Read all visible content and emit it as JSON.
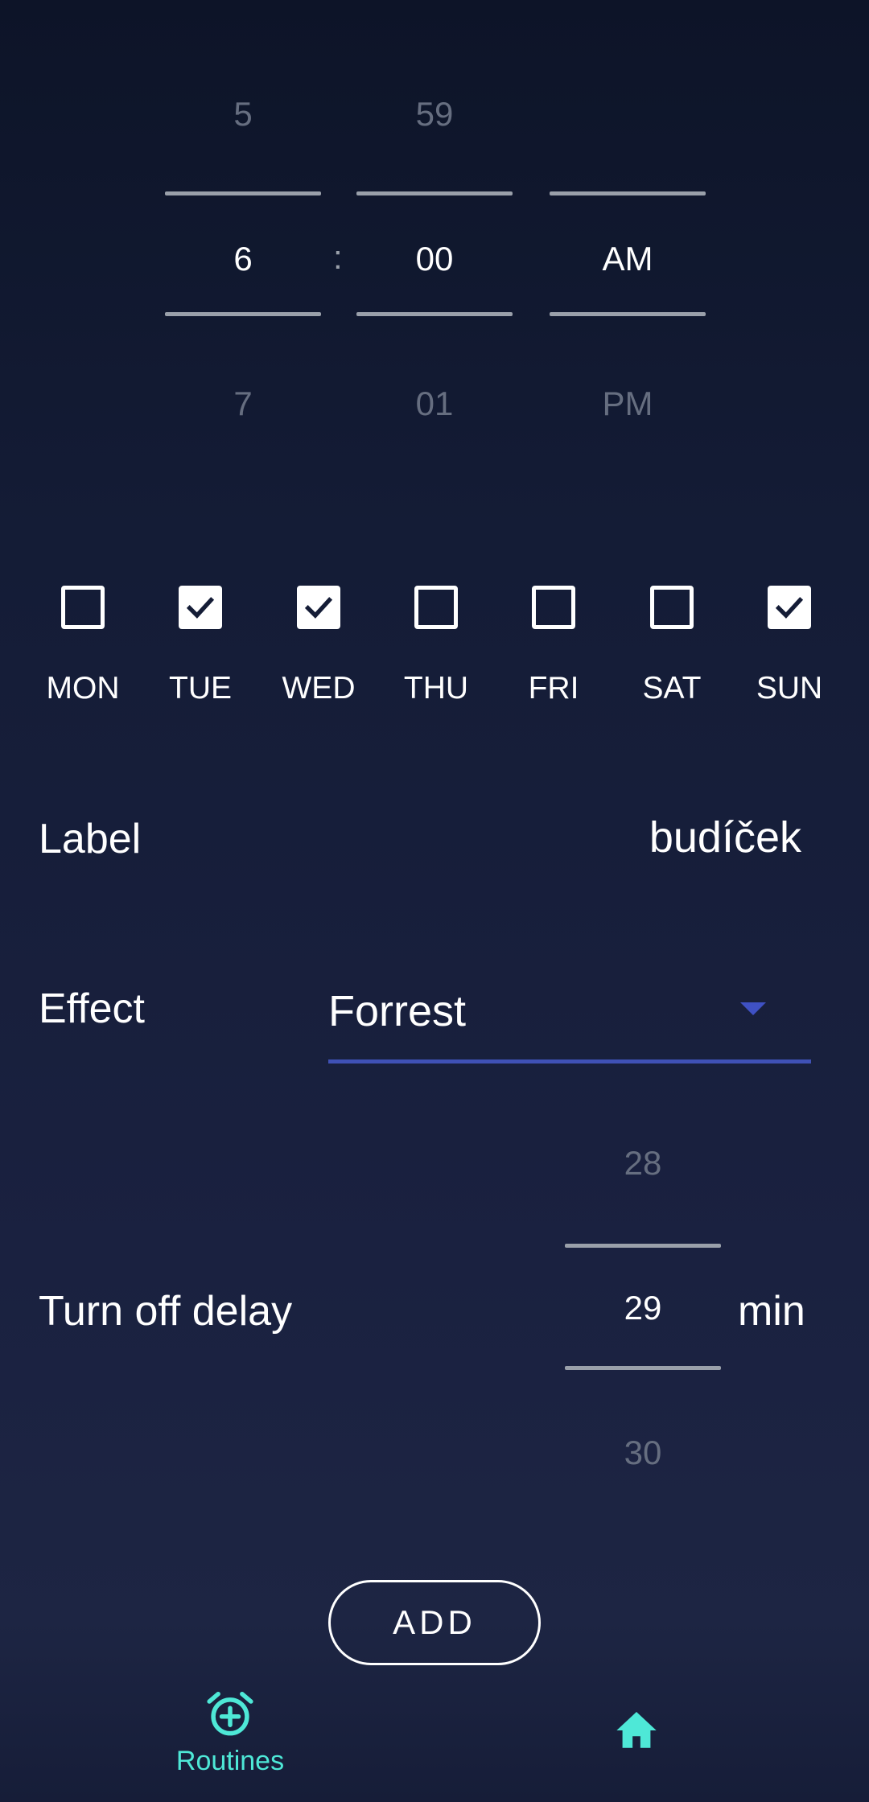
{
  "time_picker": {
    "hour": {
      "above": "5",
      "selected": "6",
      "below": "7"
    },
    "separator": ":",
    "minute": {
      "above": "59",
      "selected": "00",
      "below": "01"
    },
    "period": {
      "above": "",
      "selected": "AM",
      "below": "PM"
    }
  },
  "days": [
    {
      "label": "MON",
      "checked": false
    },
    {
      "label": "TUE",
      "checked": true
    },
    {
      "label": "WED",
      "checked": true
    },
    {
      "label": "THU",
      "checked": false
    },
    {
      "label": "FRI",
      "checked": false
    },
    {
      "label": "SAT",
      "checked": false
    },
    {
      "label": "SUN",
      "checked": true
    }
  ],
  "label_row": {
    "title": "Label",
    "value": "budíček"
  },
  "effect_row": {
    "title": "Effect",
    "selected": "Forrest"
  },
  "delay_row": {
    "title": "Turn off delay",
    "above": "28",
    "selected": "29",
    "below": "30",
    "unit": "min"
  },
  "add_button": {
    "label": "ADD"
  },
  "bottom_nav": {
    "items": [
      {
        "label": "Routines",
        "icon": "alarm-add-icon",
        "active": true
      },
      {
        "label": "",
        "icon": "home-icon",
        "active": false
      }
    ]
  },
  "colors": {
    "accent": "#4ee8d7",
    "underline": "#3f51b5",
    "background": "#141c36"
  }
}
